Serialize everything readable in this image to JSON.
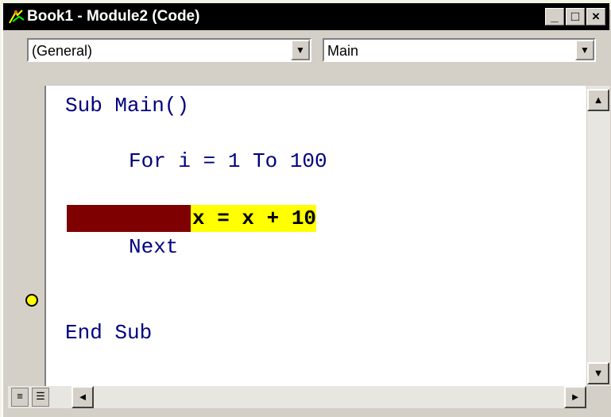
{
  "window": {
    "title": "Book1 - Module2 (Code)",
    "buttons": [
      "_",
      "□",
      "×"
    ]
  },
  "toolbar": {
    "object_combo": {
      "value": "(General)",
      "arrow": "▼"
    },
    "procedure_combo": {
      "value": "Main",
      "arrow": "▼"
    }
  },
  "code": {
    "lines": [
      "Sub Main()",
      "For i = 1 To 100",
      "x = x + 10",
      "Next",
      "End Sub"
    ],
    "current_line_index": 2,
    "highlight_color": "#ffff00",
    "breakpoint_color": "#7f0000",
    "keyword_color": "#00007f"
  },
  "gutter": {
    "execution_pointer_icon": "current-line-arrow-icon"
  },
  "scrollbars": {
    "up": "▲",
    "down": "▼",
    "left": "◄",
    "right": "►"
  },
  "view_buttons": {
    "procedure_view": "≡",
    "full_module_view": "☰"
  }
}
